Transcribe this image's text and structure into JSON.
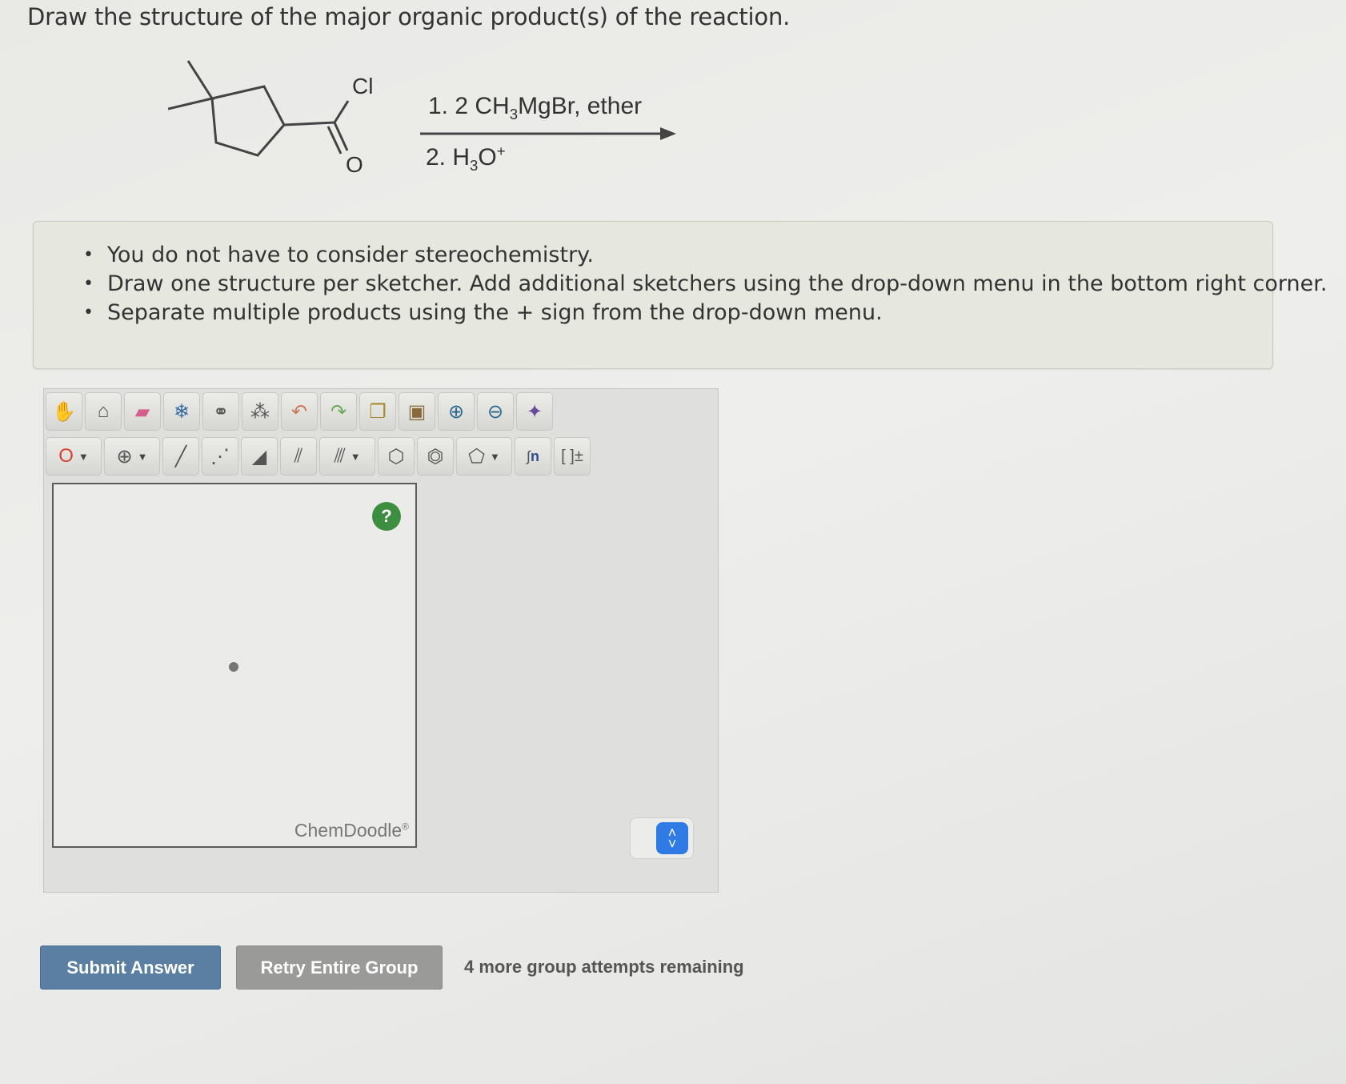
{
  "question": "Draw the structure of the major organic product(s) of the reaction.",
  "reaction": {
    "atom_label": "Cl",
    "oxygen_label": "O",
    "step1_prefix": "1. 2 CH",
    "step1_sub": "3",
    "step1_suffix": "MgBr, ether",
    "step2_prefix": "2. H",
    "step2_sub": "3",
    "step2_o": "O",
    "step2_sup": "+"
  },
  "instructions": [
    "You do not have to consider stereochemistry.",
    "Draw one structure per sketcher. Add additional sketchers using the drop-down menu in the bottom right corner.",
    "Separate multiple products using the + sign from the drop-down menu."
  ],
  "sketcher": {
    "toolbar_row1": [
      "hand-icon",
      "lasso-icon",
      "eraser-icon",
      "template-icon",
      "chain-icon",
      "molecule-icon",
      "undo-icon",
      "redo-icon",
      "copy-icon",
      "paste-icon",
      "zoom-in-icon",
      "zoom-out-icon",
      "clean-icon"
    ],
    "atom_selector": "O",
    "charge_symbol": "⊕",
    "polymer_label": "n",
    "bracket_label": "[ ]±",
    "help_label": "?",
    "brand": "ChemDoodle",
    "brand_mark": "®"
  },
  "buttons": {
    "submit": "Submit Answer",
    "retry": "Retry Entire Group"
  },
  "attempts_text": "4 more group attempts remaining",
  "colors": {
    "submit": "#5a7fa3",
    "retry": "#9a9b99",
    "help": "#3e8e42",
    "select": "#2f7ae5",
    "atom_o": "#d8402e"
  }
}
